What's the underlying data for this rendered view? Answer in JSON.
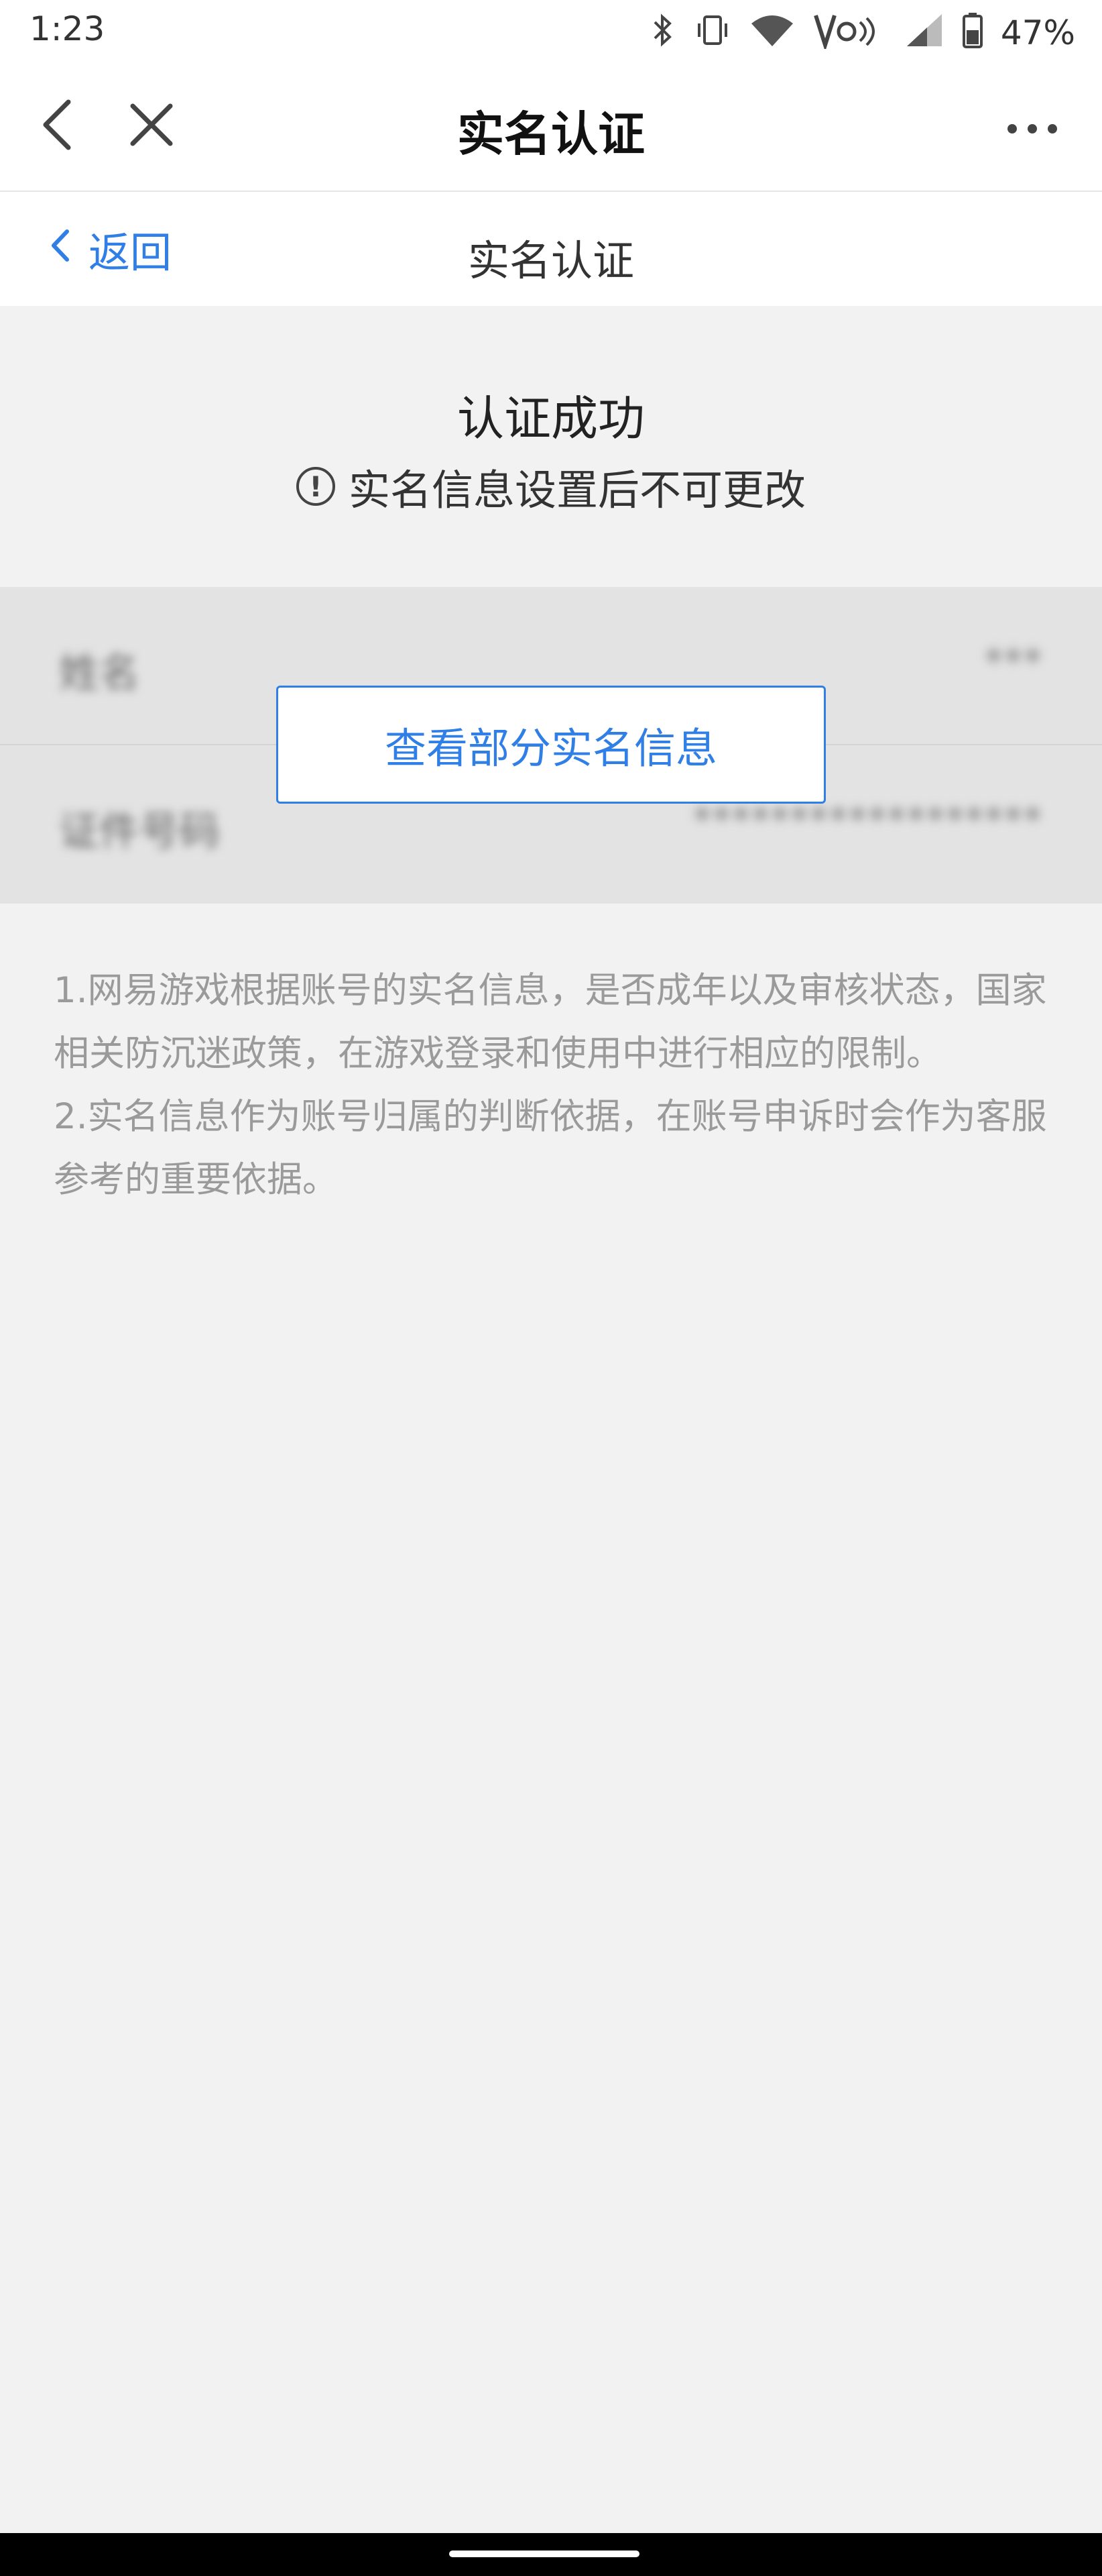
{
  "status_bar": {
    "time": "1:23",
    "battery_percent": "47%",
    "icons": [
      "bluetooth-icon",
      "vibrate-icon",
      "wifi-icon",
      "volte-icon",
      "signal-icon",
      "battery-icon"
    ]
  },
  "title_bar": {
    "title": "实名认证",
    "back_icon": "chevron-left-icon",
    "close_icon": "close-icon",
    "more_icon": "more-dots-icon"
  },
  "sub_nav": {
    "back_label": "返回",
    "title": "实名认证"
  },
  "result": {
    "title": "认证成功",
    "note": "实名信息设置后不可更改",
    "note_icon_glyph": "!"
  },
  "info": {
    "rows": [
      {
        "label": "姓名",
        "value": "***"
      },
      {
        "label": "证件号码",
        "value": "******************"
      }
    ],
    "view_button_label": "查看部分实名信息"
  },
  "description": [
    "1.网易游戏根据账号的实名信息，是否成年以及审核状态，国家相关防沉迷政策，在游戏登录和使用中进行相应的限制。",
    "2.实名信息作为账号归属的判断依据，在账号申诉时会作为客服参考的重要依据。"
  ],
  "colors": {
    "accent": "#2f7fe6",
    "background": "#f2f2f2",
    "muted_text": "#9a9a9a"
  }
}
